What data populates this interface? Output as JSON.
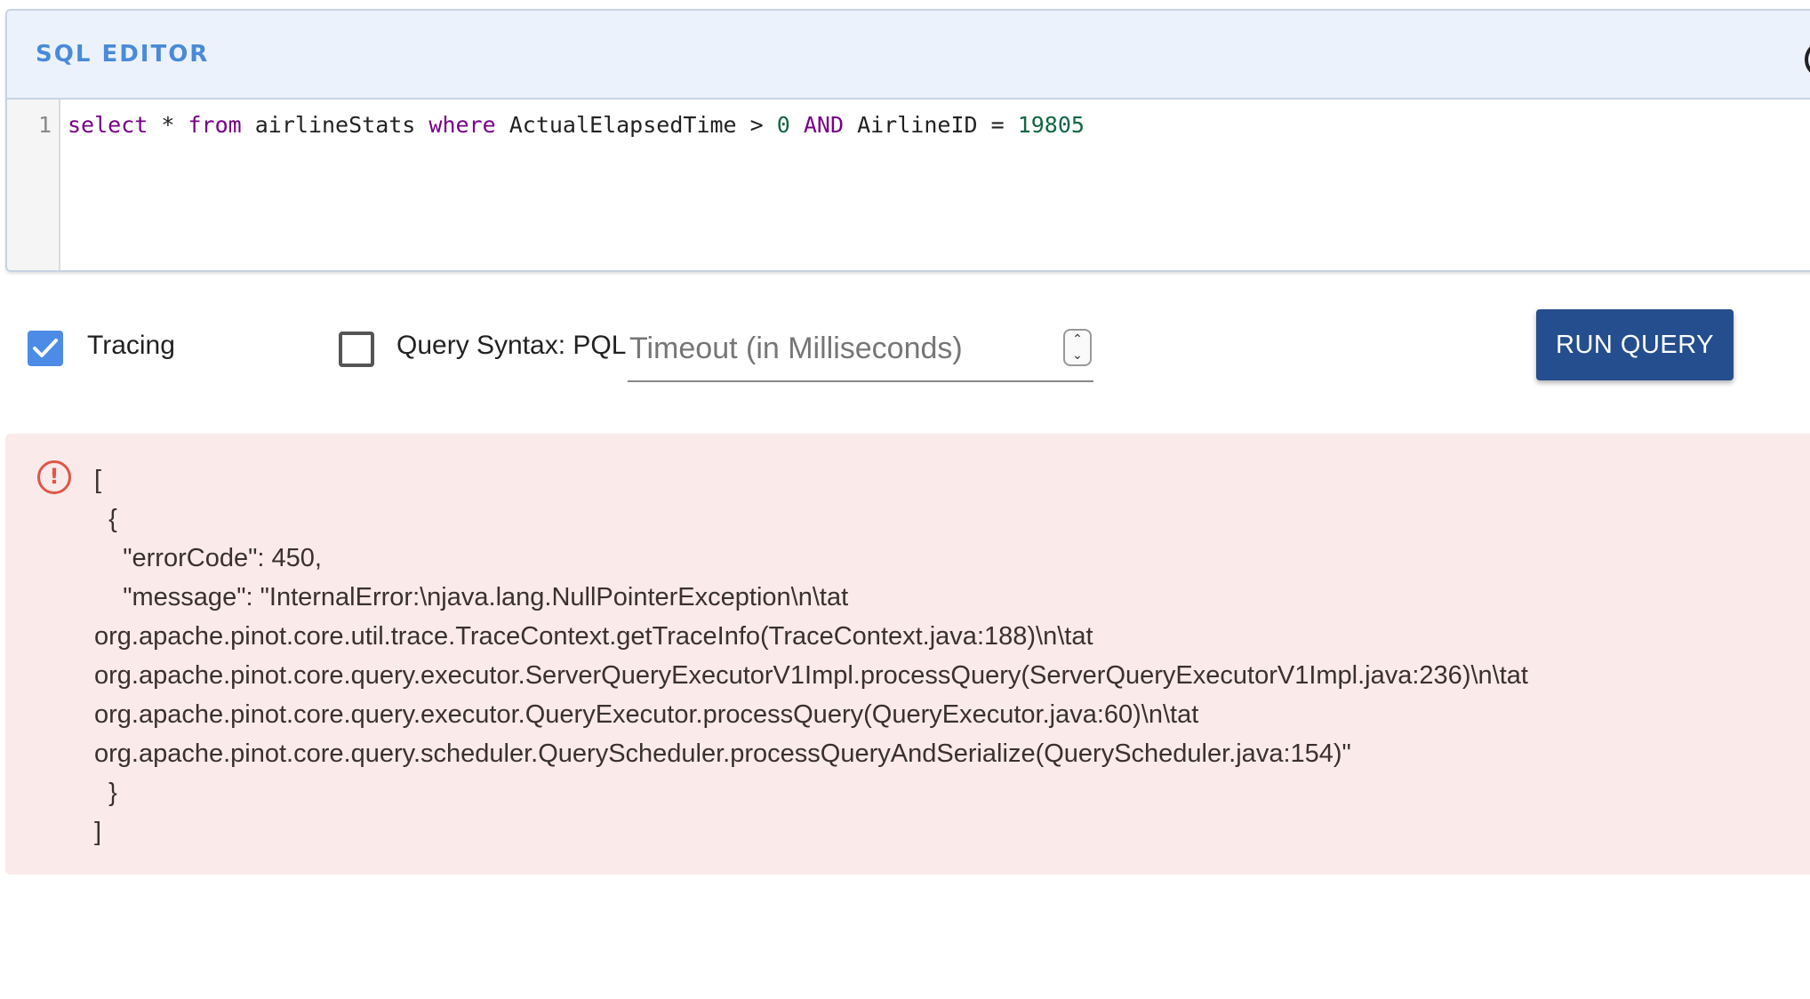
{
  "editor": {
    "title": "SQL EDITOR",
    "line_number": "1",
    "query_tokens": [
      {
        "text": "select",
        "kind": "kw"
      },
      {
        "text": " * ",
        "kind": "plain"
      },
      {
        "text": "from",
        "kind": "kw"
      },
      {
        "text": " airlineStats ",
        "kind": "plain"
      },
      {
        "text": "where",
        "kind": "kw"
      },
      {
        "text": " ActualElapsedTime > ",
        "kind": "plain"
      },
      {
        "text": "0",
        "kind": "num"
      },
      {
        "text": " ",
        "kind": "plain"
      },
      {
        "text": "AND",
        "kind": "kw"
      },
      {
        "text": " AirlineID = ",
        "kind": "plain"
      },
      {
        "text": "19805",
        "kind": "num"
      }
    ]
  },
  "controls": {
    "tracing_label": "Tracing",
    "tracing_checked": true,
    "syntax_label": "Query Syntax: PQL",
    "syntax_checked": false,
    "timeout_placeholder": "Timeout (in Milliseconds)",
    "timeout_value": "",
    "run_label": "RUN QUERY"
  },
  "error": {
    "icon": "error-outline-icon",
    "lines": [
      "[",
      "  {",
      "    \"errorCode\": 450,",
      "    \"message\": \"InternalError:\\njava.lang.NullPointerException\\n\\tat",
      "org.apache.pinot.core.util.trace.TraceContext.getTraceInfo(TraceContext.java:188)\\n\\tat",
      "org.apache.pinot.core.query.executor.ServerQueryExecutorV1Impl.processQuery(ServerQueryExecutorV1Impl.java:236)\\n\\tat",
      "org.apache.pinot.core.query.executor.QueryExecutor.processQuery(QueryExecutor.java:60)\\n\\tat",
      "org.apache.pinot.core.query.scheduler.QueryScheduler.processQueryAndSerialize(QueryScheduler.java:154)\"",
      "  }",
      "]"
    ]
  },
  "colors": {
    "accent": "#4a8ad8",
    "run_button": "#254e8e",
    "error_bg": "#faeaea",
    "error_icon": "#e05547"
  }
}
